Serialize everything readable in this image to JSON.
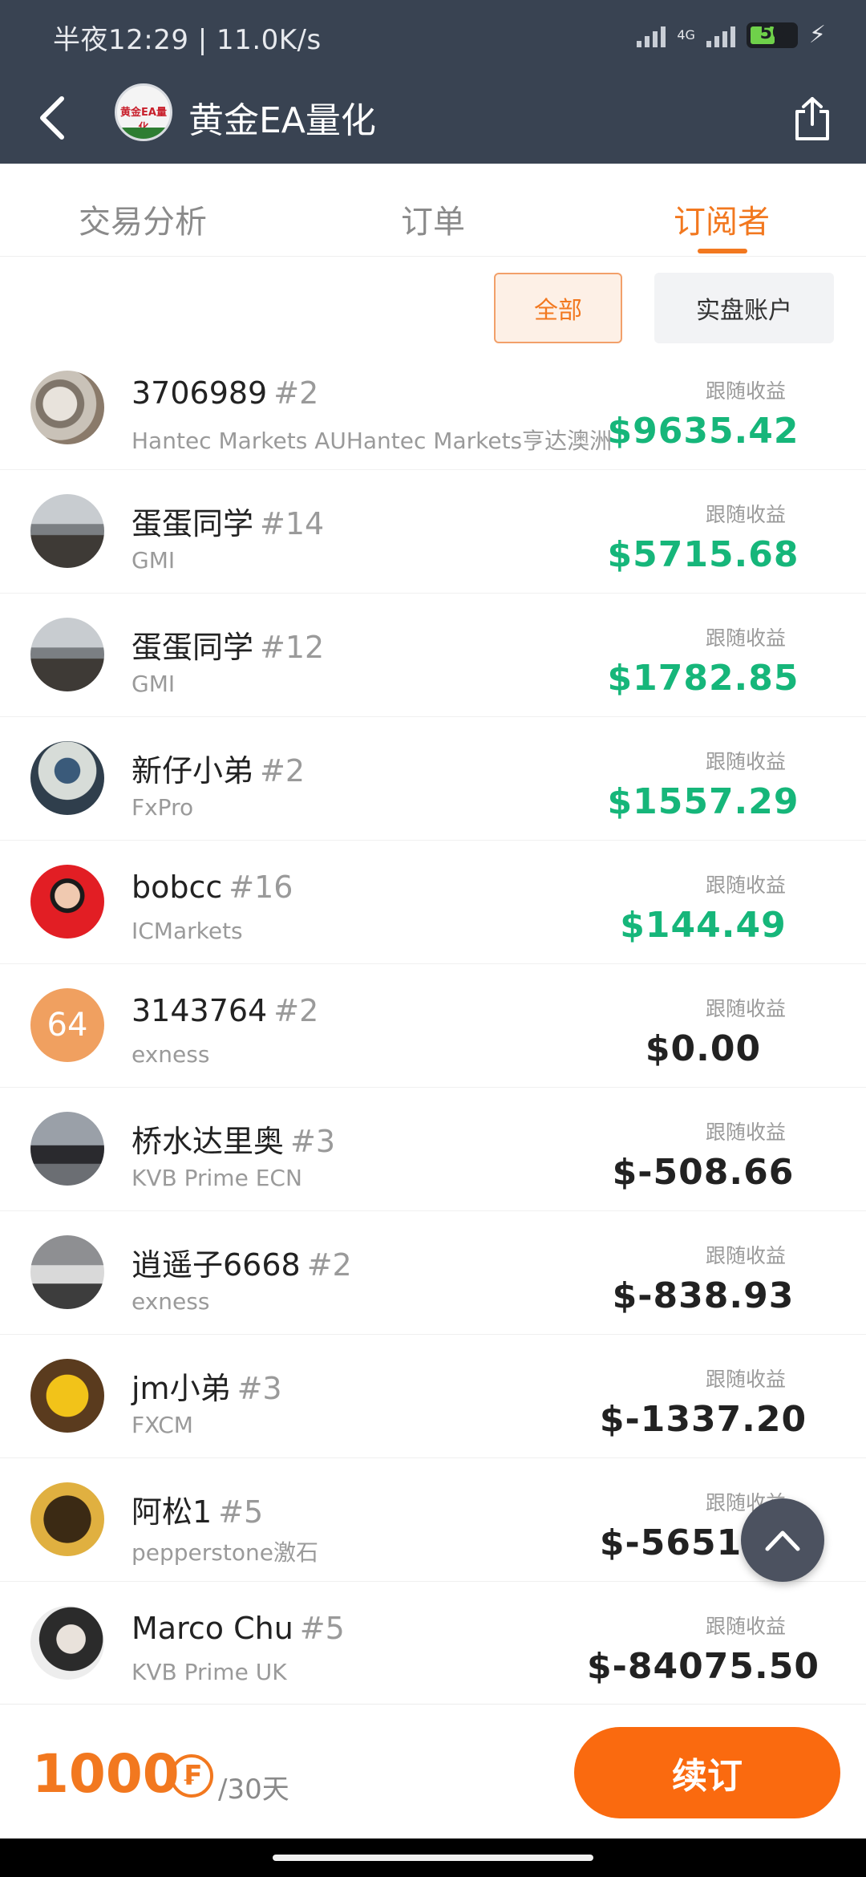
{
  "status_bar": {
    "left_text": "半夜12:29 | 11.0K/s",
    "network": "4G",
    "battery": "50"
  },
  "nav": {
    "title": "黄金EA量化",
    "logo_text": "黄金EA量化"
  },
  "tabs": [
    {
      "label": "交易分析"
    },
    {
      "label": "订单"
    },
    {
      "label": "订阅者"
    }
  ],
  "filters": {
    "all": "全部",
    "real": "实盘账户"
  },
  "subscribers": [
    {
      "name": "3706989",
      "rank": "#2",
      "broker": "Hantec Markets AUHantec Markets亨达澳洲",
      "profit_label": "跟随收益",
      "profit": "$9635.42"
    },
    {
      "name": "蛋蛋同学",
      "rank": "#14",
      "broker": "GMI",
      "profit_label": "跟随收益",
      "profit": "$5715.68"
    },
    {
      "name": "蛋蛋同学",
      "rank": "#12",
      "broker": "GMI",
      "profit_label": "跟随收益",
      "profit": "$1782.85"
    },
    {
      "name": "新仔小弟",
      "rank": "#2",
      "broker": "FxPro",
      "profit_label": "跟随收益",
      "profit": "$1557.29"
    },
    {
      "name": "bobcc",
      "rank": "#16",
      "broker": "ICMarkets",
      "profit_label": "跟随收益",
      "profit": "$144.49"
    },
    {
      "name": "3143764",
      "rank": "#2",
      "broker": "exness",
      "profit_label": "跟随收益",
      "profit": "$0.00",
      "avatar_text": "64"
    },
    {
      "name": "桥水达里奥",
      "rank": "#3",
      "broker": "KVB Prime ECN",
      "profit_label": "跟随收益",
      "profit": "$-508.66"
    },
    {
      "name": "逍遥子6668",
      "rank": "#2",
      "broker": "exness",
      "profit_label": "跟随收益",
      "profit": "$-838.93"
    },
    {
      "name": "jm小弟",
      "rank": "#3",
      "broker": "FXCM",
      "profit_label": "跟随收益",
      "profit": "$-1337.20"
    },
    {
      "name": "阿松1",
      "rank": "#5",
      "broker": "pepperstone激石",
      "profit_label": "跟随收益",
      "profit": "$-5651.92"
    },
    {
      "name": "Marco Chu",
      "rank": "#5",
      "broker": "KVB Prime UK",
      "profit_label": "跟随收益",
      "profit": "$-84075.50"
    }
  ],
  "footer": {
    "price": "1000",
    "coin_symbol": "₣",
    "period": "/30天",
    "renew_label": "续订"
  },
  "colors": {
    "accent": "#f2781f",
    "positive": "#16b67a",
    "header_bg": "#394352"
  }
}
